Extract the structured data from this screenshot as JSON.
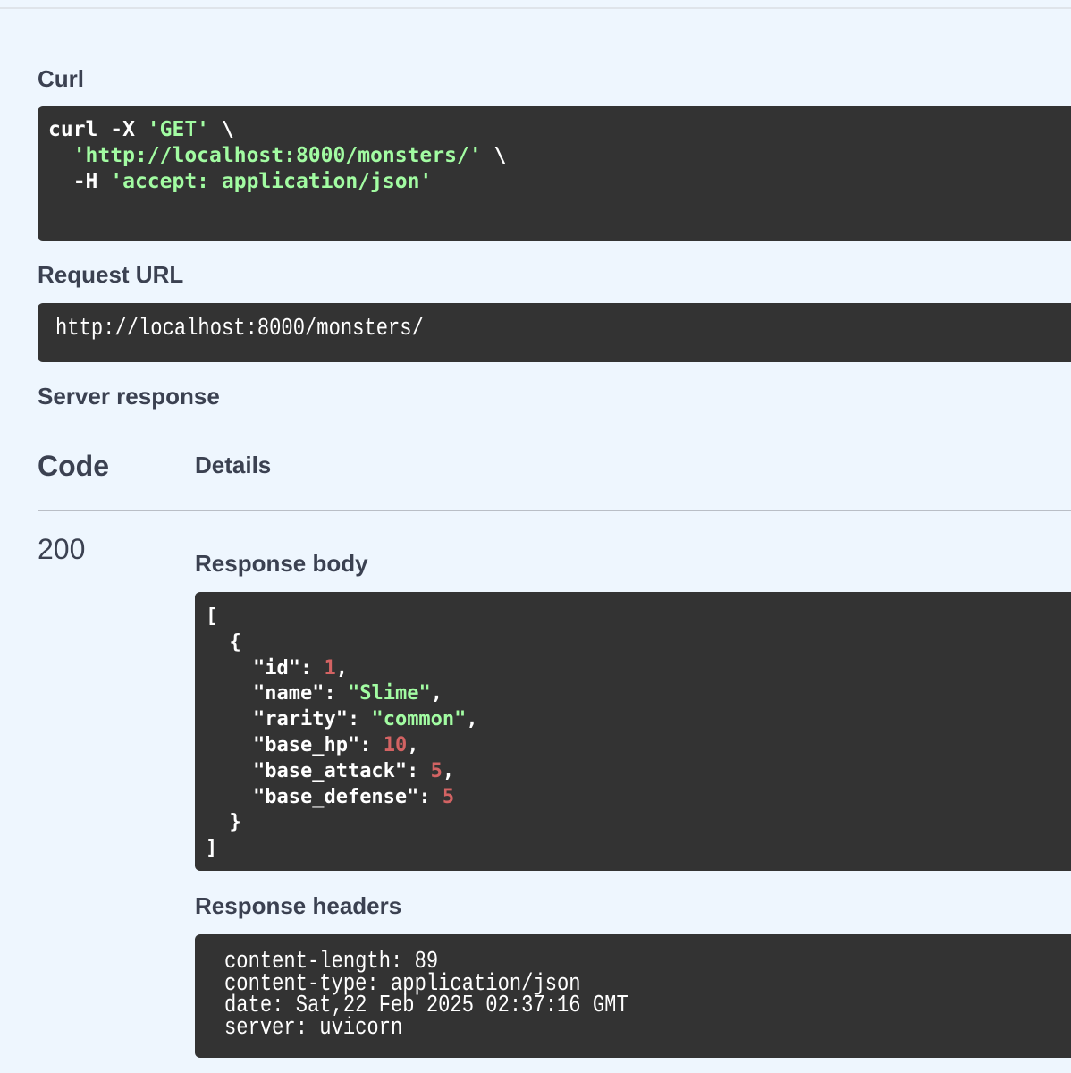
{
  "curl": {
    "title": "Curl",
    "cmd_prefix": "curl -X ",
    "method": "'GET'",
    "line1_suffix": " \\",
    "line2_indent": "  ",
    "url": "'http://localhost:8000/monsters/'",
    "line2_suffix": " \\",
    "line3_prefix": "  -H ",
    "header": "'accept: application/json'"
  },
  "request_url": {
    "title": "Request URL",
    "value": "http://localhost:8000/monsters/"
  },
  "server_response": {
    "title": "Server response",
    "code_label": "Code",
    "details_label": "Details",
    "status_code": "200",
    "response_body_title": "Response body",
    "body": {
      "open_bracket": "[",
      "open_brace": "  {",
      "fields": [
        {
          "key": "\"id\"",
          "value": "1",
          "type": "number",
          "comma": ","
        },
        {
          "key": "\"name\"",
          "value": "\"Slime\"",
          "type": "string",
          "comma": ","
        },
        {
          "key": "\"rarity\"",
          "value": "\"common\"",
          "type": "string",
          "comma": ","
        },
        {
          "key": "\"base_hp\"",
          "value": "10",
          "type": "number",
          "comma": ","
        },
        {
          "key": "\"base_attack\"",
          "value": "5",
          "type": "number",
          "comma": ","
        },
        {
          "key": "\"base_defense\"",
          "value": "5",
          "type": "number",
          "comma": ""
        }
      ],
      "close_brace": "  }",
      "close_bracket": "]"
    },
    "response_headers_title": "Response headers",
    "headers": [
      "content-length: 89",
      "content-type: application/json",
      "date: Sat,22 Feb 2025 02:37:16 GMT",
      "server: uvicorn"
    ]
  },
  "colors": {
    "background": "#eef6fe",
    "code_bg": "#333333",
    "string": "#a2fca2",
    "number": "#d36363",
    "heading": "#3b4151"
  }
}
